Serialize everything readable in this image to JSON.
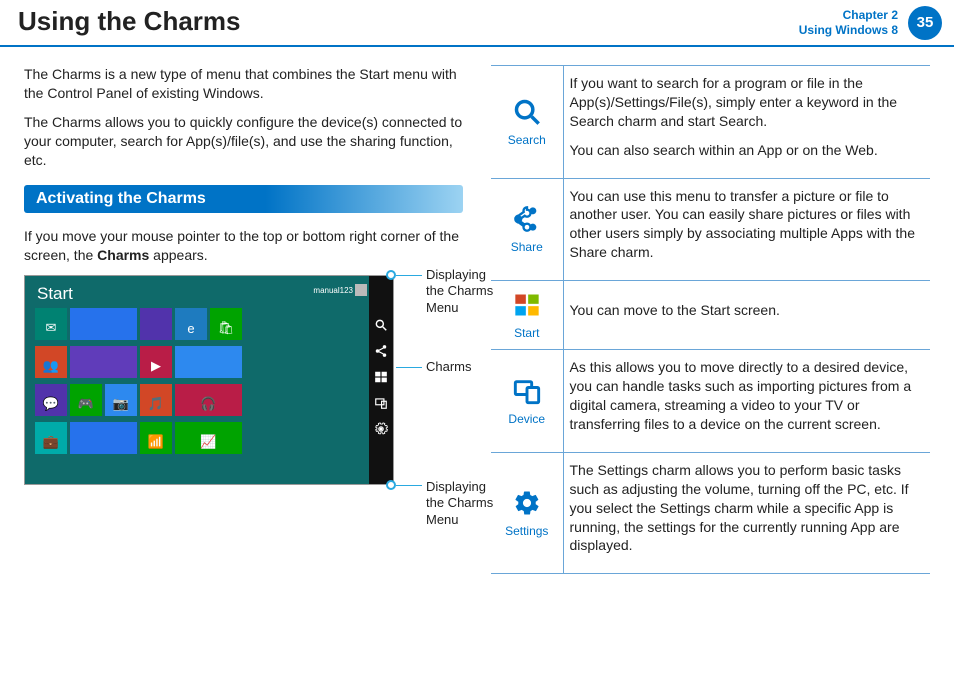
{
  "header": {
    "title": "Using the Charms",
    "chapter_line1": "Chapter 2",
    "chapter_line2": "Using Windows 8",
    "page_number": "35"
  },
  "left": {
    "intro1": "The Charms is a new type of menu that combines the Start menu with the Control Panel of existing Windows.",
    "intro2": "The Charms allows you to quickly configure the device(s) connected to your computer, search for App(s)/file(s), and use the sharing function, etc.",
    "section_title": "Activating the Charms",
    "instruction_pre": "If you move your mouse pointer to the top or bottom right corner of the screen, the ",
    "instruction_bold": "Charms",
    "instruction_post": " appears.",
    "screenshot": {
      "title": "Start",
      "user": "manual123"
    },
    "callouts": {
      "top": "Displaying the Charms Menu",
      "middle": "Charms",
      "bottom": "Displaying the Charms Menu"
    }
  },
  "right": {
    "rows": [
      {
        "label": "Search",
        "para1": "If you want to search for a program or file in the App(s)/Settings/File(s), simply enter a keyword in the Search charm and start Search.",
        "para2": "You can also search within an App or on the Web."
      },
      {
        "label": "Share",
        "para1": "You can use this menu to transfer a picture or file to another user. You can easily share pictures or files with other users simply by associating multiple Apps with the Share charm."
      },
      {
        "label": "Start",
        "para1": "You can move to the Start screen."
      },
      {
        "label": "Device",
        "para1": "As this allows you to move directly to a desired device, you can handle tasks such as importing pictures from a digital camera, streaming a video to your TV or transferring files to a device on the current screen."
      },
      {
        "label": "Settings",
        "para1": "The Settings charm allows you to perform basic tasks such as adjusting the volume, turning off the PC, etc. If you select the Settings charm while a specific App is running, the settings for the currently running App are displayed."
      }
    ]
  }
}
